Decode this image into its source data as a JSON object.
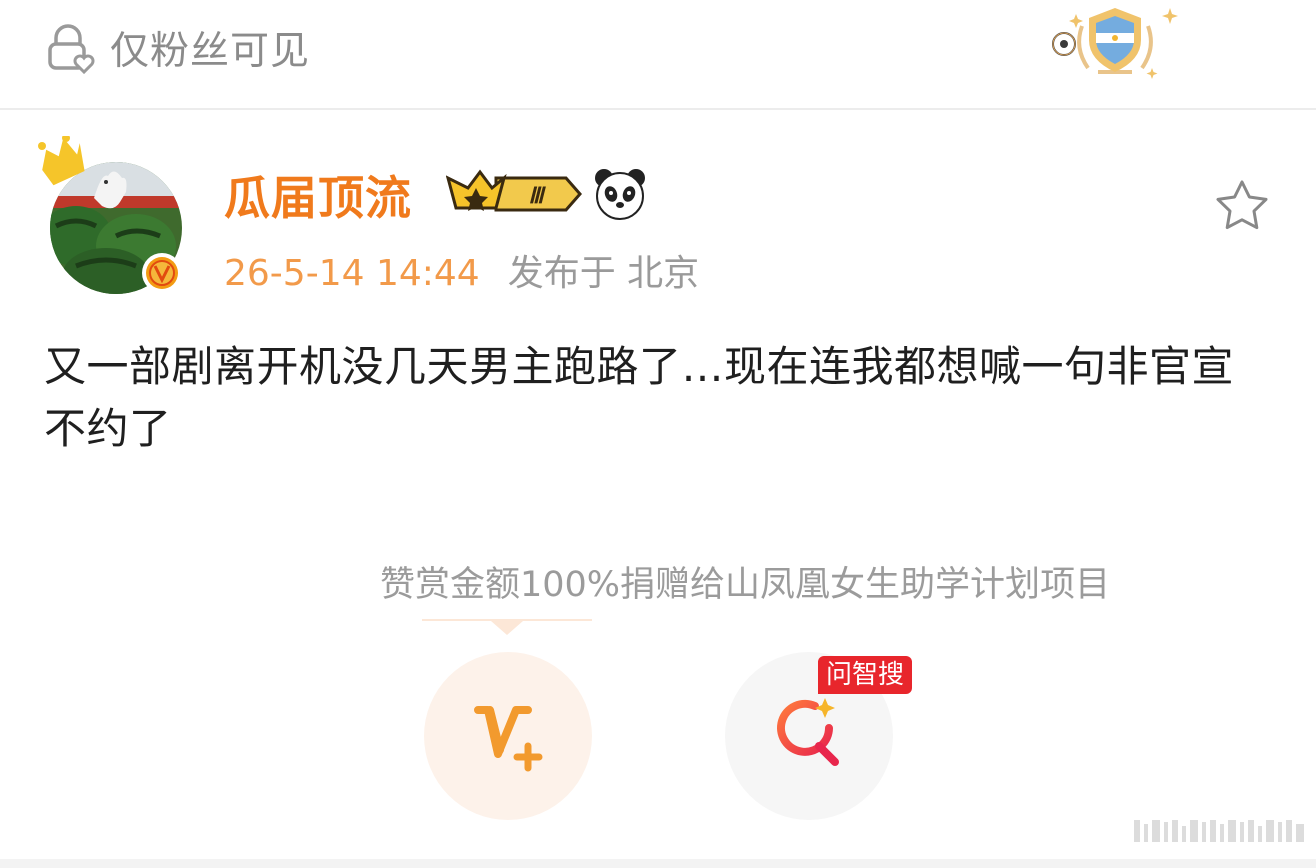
{
  "top_bar": {
    "visibility_label": "仅粉丝可见"
  },
  "author": {
    "name": "瓜届顶流",
    "level_badge": "Ⅲ",
    "time": "26-5-14 14:44",
    "published_at": "发布于 北京"
  },
  "post": {
    "text": "又一部剧离开机没几天男主跑路了…现在连我都想喊一句非官宣不约了"
  },
  "reward": {
    "text": "赞赏金额100%捐赠给山凤凰女生助学计划项目"
  },
  "actions": {
    "zhisou_tag": "问智搜"
  },
  "colors": {
    "accent_orange": "#f07a1c",
    "time_orange": "#f29a4a",
    "zhisou_red": "#e8262c",
    "text_gray": "#8b8b8b",
    "body_text": "#1f1f1f"
  },
  "icons": [
    "lock-heart-icon",
    "argentina-badge-icon",
    "verified-v-icon",
    "crown-icon",
    "level-iii-badge-icon",
    "panda-icon",
    "star-outline-icon",
    "v-plus-icon",
    "zhisou-search-icon"
  ]
}
